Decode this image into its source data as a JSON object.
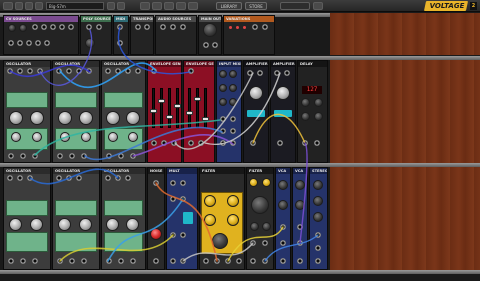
{
  "toolbar": {
    "menu_label": "",
    "preset_name": "Big-S7m",
    "library_label": "LIBRARY",
    "store_label": "STORE"
  },
  "logo": {
    "brand": "VOLTAGE",
    "version": "2"
  },
  "colors": {
    "oscillator_panel": "#3c3c3c",
    "oscillator_face": "#6fb38a",
    "filter_red": "#8c0f24",
    "sequencer_blue": "#25336a",
    "amplifier_panel": "#1b1b22",
    "yellow_module": "#e0b21f",
    "rack_wood": "#7a3519",
    "logo_yellow": "#e9b42a"
  },
  "rack_rows": [
    {
      "name": "io-row",
      "modules": [
        {
          "id": "cv-sources",
          "title": "CV SOURCES"
        },
        {
          "id": "poly-sources",
          "title": "POLY SOURCES"
        },
        {
          "id": "midi",
          "title": "MIDI"
        },
        {
          "id": "transport",
          "title": "TRANSPORT"
        },
        {
          "id": "audio-sources",
          "title": "AUDIO SOURCES"
        },
        {
          "id": "main-outs",
          "title": "MAIN OUTS"
        },
        {
          "id": "variations",
          "title": "VARIATIONS"
        }
      ]
    },
    {
      "name": "row-1",
      "modules": [
        {
          "id": "osc-1",
          "title": "OSCILLATOR",
          "knob_labels": [
            "FREQUENCY",
            "SHAPE"
          ]
        },
        {
          "id": "osc-2",
          "title": "OSCILLATOR",
          "knob_labels": [
            "FREQUENCY",
            "SHAPE"
          ]
        },
        {
          "id": "osc-3",
          "title": "OSCILLATOR",
          "knob_labels": [
            "FREQUENCY",
            "SHAPE"
          ]
        },
        {
          "id": "envelope",
          "title": "ENVELOPE GENERATOR"
        },
        {
          "id": "envelope-2",
          "title": "ENVELOPE GENERATOR"
        },
        {
          "id": "input-mixer",
          "title": "INPUT MIXER"
        },
        {
          "id": "amplifier-1",
          "title": "AMPLIFIER"
        },
        {
          "id": "amplifier-2",
          "title": "AMPLIFIER"
        },
        {
          "id": "delay",
          "title": "DELAY"
        }
      ]
    },
    {
      "name": "row-2",
      "modules": [
        {
          "id": "osc-4",
          "title": "OSCILLATOR",
          "knob_labels": [
            "FREQUENCY"
          ]
        },
        {
          "id": "osc-5",
          "title": "OSCILLATOR",
          "knob_labels": [
            "FREQUENCY"
          ]
        },
        {
          "id": "osc-6",
          "title": "OSCILLATOR",
          "knob_labels": [
            "FREQUENCY"
          ]
        },
        {
          "id": "noise",
          "title": "NOISE"
        },
        {
          "id": "mult",
          "title": "MULT"
        },
        {
          "id": "filter-1",
          "title": "FILTER"
        },
        {
          "id": "filter-2",
          "title": "FILTER"
        },
        {
          "id": "vca-1",
          "title": "VCA"
        },
        {
          "id": "vca-2",
          "title": "VCA"
        },
        {
          "id": "stereo-mixer",
          "title": "STEREO MIXER"
        }
      ]
    }
  ],
  "delay_display": "127"
}
